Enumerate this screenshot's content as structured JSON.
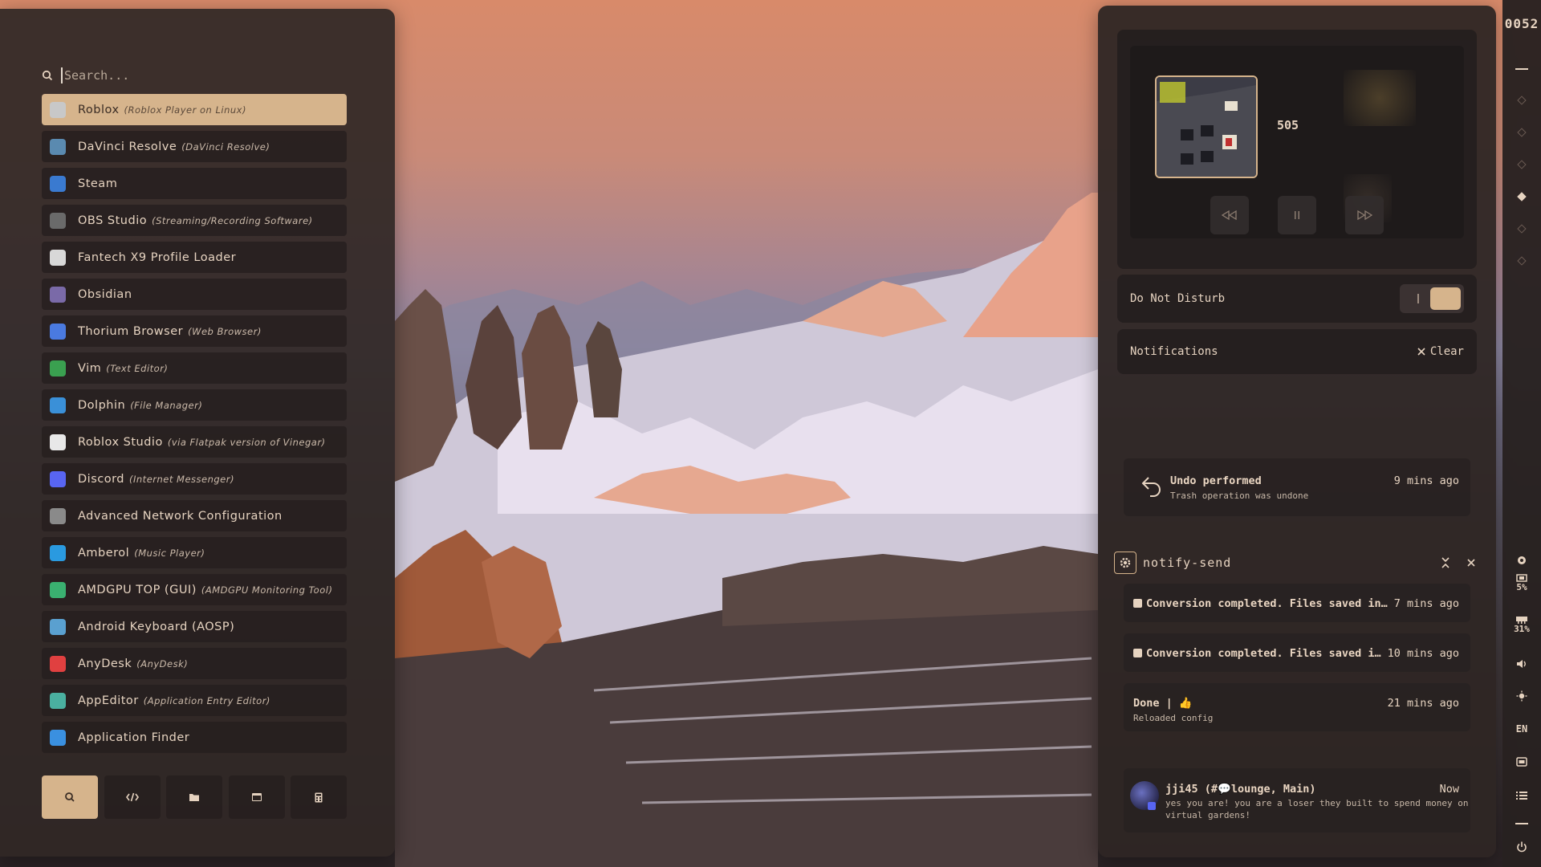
{
  "launcher": {
    "search_placeholder": "Search...",
    "apps": [
      {
        "name": "Roblox",
        "desc": "(Roblox Player on Linux)",
        "icon": "roblox-icon",
        "color": "#c8c8c8"
      },
      {
        "name": "DaVinci Resolve",
        "desc": "(DaVinci Resolve)",
        "icon": "davinci-resolve-icon",
        "color": "#5a8ab0"
      },
      {
        "name": "Steam",
        "desc": "",
        "icon": "steam-icon",
        "color": "#3a7ad0"
      },
      {
        "name": "OBS Studio",
        "desc": "(Streaming/Recording Software)",
        "icon": "obs-icon",
        "color": "#6a6a6a"
      },
      {
        "name": "Fantech X9 Profile Loader",
        "desc": "",
        "icon": "mouse-icon",
        "color": "#d8d8d8"
      },
      {
        "name": "Obsidian",
        "desc": "",
        "icon": "obsidian-icon",
        "color": "#7a6aa8"
      },
      {
        "name": "Thorium Browser",
        "desc": "(Web Browser)",
        "icon": "thorium-icon",
        "color": "#4a7ae0"
      },
      {
        "name": "Vim",
        "desc": "(Text Editor)",
        "icon": "vim-icon",
        "color": "#3aa050"
      },
      {
        "name": "Dolphin",
        "desc": "(File Manager)",
        "icon": "dolphin-icon",
        "color": "#3a90d8"
      },
      {
        "name": "Roblox Studio",
        "desc": "(via Flatpak version of Vinegar)",
        "icon": "roblox-studio-icon",
        "color": "#e8e8e8"
      },
      {
        "name": "Discord",
        "desc": "(Internet Messenger)",
        "icon": "discord-icon",
        "color": "#5865f2"
      },
      {
        "name": "Advanced Network Configuration",
        "desc": "",
        "icon": "network-icon",
        "color": "#8a8a8a"
      },
      {
        "name": "Amberol",
        "desc": "(Music Player)",
        "icon": "amberol-icon",
        "color": "#2a9ae0"
      },
      {
        "name": "AMDGPU TOP (GUI)",
        "desc": "(AMDGPU Monitoring Tool)",
        "icon": "amdgpu-icon",
        "color": "#3ab070"
      },
      {
        "name": "Android Keyboard (AOSP)",
        "desc": "",
        "icon": "keyboard-icon",
        "color": "#5aa0d0"
      },
      {
        "name": "AnyDesk",
        "desc": "(AnyDesk)",
        "icon": "anydesk-icon",
        "color": "#e04040"
      },
      {
        "name": "AppEditor",
        "desc": "(Application Entry Editor)",
        "icon": "appeditor-icon",
        "color": "#4ab0a0"
      },
      {
        "name": "Application Finder",
        "desc": "",
        "icon": "app-finder-icon",
        "color": "#3a90e0"
      }
    ],
    "tabs": [
      "search-tab",
      "code-tab",
      "files-tab",
      "window-tab",
      "calculator-tab"
    ]
  },
  "media": {
    "track_title": "505",
    "controls": [
      "previous",
      "pause",
      "next"
    ]
  },
  "dnd": {
    "label": "Do Not Disturb"
  },
  "notifications": {
    "header": "Notifications",
    "clear_label": "Clear",
    "undo": {
      "title": "Undo performed",
      "body": "Trash operation was undone",
      "time": "9 mins ago"
    },
    "group": {
      "title": "notify-send",
      "items": [
        {
          "title": "Conversion completed. Files saved in…",
          "time": "7 mins ago"
        },
        {
          "title": "Conversion completed. Files saved i…",
          "time": "10 mins ago"
        },
        {
          "title": "Done | 👍",
          "body": "Reloaded config",
          "time": "21 mins ago"
        }
      ]
    },
    "chat": {
      "title": "jji45 (#💬lounge, Main)",
      "body_line1": "yes you are! you are a loser they built to spend money on",
      "body_line2": "virtual gardens!",
      "time": "Now"
    }
  },
  "sidebar": {
    "clock_hour": "00",
    "clock_min": "52",
    "cpu_label": "5%",
    "ram_label": "31%",
    "lang": "EN"
  },
  "colors": {
    "accent": "#d6b48c",
    "panel": "#2e2624",
    "text": "#e6d3c0"
  }
}
